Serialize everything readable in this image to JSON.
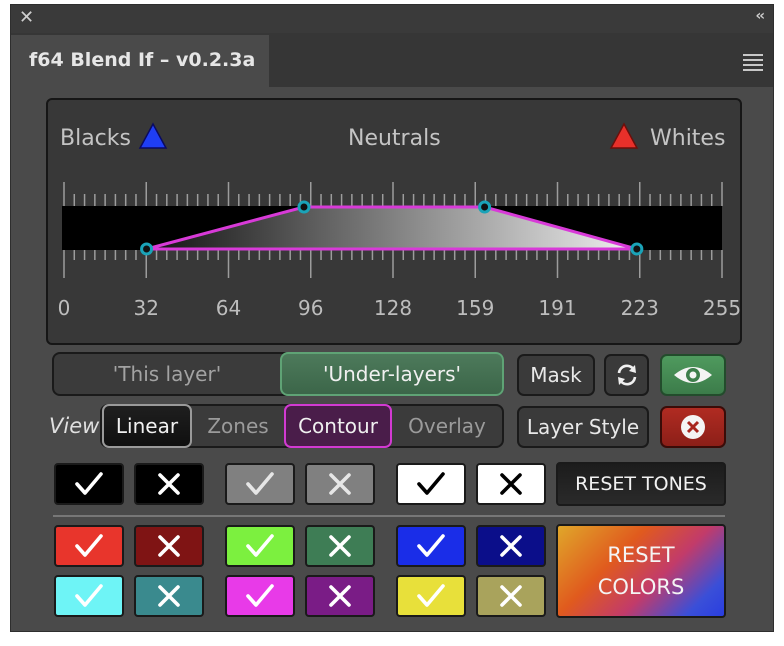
{
  "window": {
    "close_glyph": "✕",
    "collapse_glyph": "‹‹"
  },
  "tab": {
    "title": "f64 Blend If – v0.2.3a"
  },
  "graph": {
    "label_blacks": "Blacks",
    "label_neutrals": "Neutrals",
    "label_whites": "Whites",
    "scale": [
      "0",
      "32",
      "64",
      "96",
      "128",
      "159",
      "191",
      "223",
      "255"
    ],
    "trapezoid": {
      "black_low": 32,
      "black_high": 93,
      "white_high": 163,
      "white_low": 222
    },
    "colors": {
      "black_marker": "#1f3ef5",
      "white_marker": "#e8302a",
      "outline": "#d83ad8",
      "handle": "#1aa3b8"
    }
  },
  "source_toggle": {
    "this_layer": "'This layer'",
    "under_layers": "'Under-layers'",
    "selected": "Under-layers"
  },
  "buttons": {
    "mask": "Mask",
    "layer_style": "Layer Style",
    "refresh_icon": "refresh-icon",
    "eye_icon": "eye-icon",
    "delete_icon": "close-circle-icon"
  },
  "view": {
    "label": "View",
    "options": [
      "Linear",
      "Zones",
      "Contour",
      "Overlay"
    ],
    "selected": [
      "Linear",
      "Contour"
    ]
  },
  "tones": [
    {
      "name": "black",
      "color": "#000000",
      "mark": "#ffffff"
    },
    {
      "name": "gray",
      "color": "#808080",
      "mark": "#e6e6e6"
    },
    {
      "name": "white",
      "color": "#ffffff",
      "mark": "#000000"
    }
  ],
  "colors_grid": [
    {
      "name": "red",
      "on": "#e8352c",
      "off": "#7f1414"
    },
    {
      "name": "green",
      "on": "#7cf03f",
      "off": "#3e7d55"
    },
    {
      "name": "blue",
      "on": "#1a2de8",
      "off": "#0b0e8a"
    },
    {
      "name": "cyan",
      "on": "#6ef4f6",
      "off": "#3a8a8e"
    },
    {
      "name": "magenta",
      "on": "#e83ae8",
      "off": "#7a1c86"
    },
    {
      "name": "yellow",
      "on": "#e8e03a",
      "off": "#a9a35c"
    }
  ],
  "reset_tones": "RESET TONES",
  "reset_colors_line1": "RESET",
  "reset_colors_line2": "COLORS"
}
